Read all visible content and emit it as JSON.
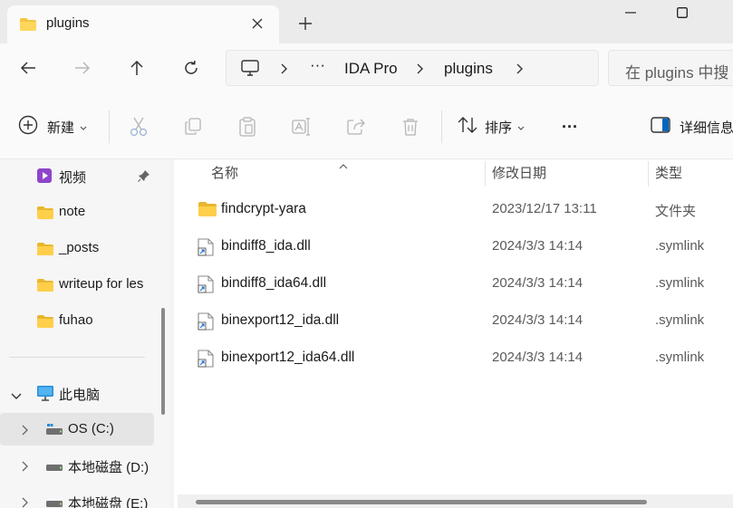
{
  "tab": {
    "title": "plugins"
  },
  "address": {
    "overflow": "···",
    "crumbs": [
      "IDA Pro",
      "plugins"
    ]
  },
  "search": {
    "placeholder": "在 plugins 中搜"
  },
  "toolbar": {
    "new_label": "新建",
    "sort_label": "排序",
    "more_label": "···",
    "details_label": "详细信息"
  },
  "sidebar": {
    "quick_access": [
      {
        "label": "视频",
        "icon": "video-folder-icon",
        "pinned": true
      },
      {
        "label": "note",
        "icon": "folder-icon"
      },
      {
        "label": "_posts",
        "icon": "folder-icon"
      },
      {
        "label": "writeup for les",
        "icon": "folder-icon"
      },
      {
        "label": "fuhao",
        "icon": "folder-icon"
      }
    ],
    "this_pc": {
      "label": "此电脑",
      "expanded": true
    },
    "drives": [
      {
        "label": "OS (C:)",
        "selected": true
      },
      {
        "label": "本地磁盘 (D:)"
      },
      {
        "label": "本地磁盘 (E:)"
      }
    ]
  },
  "columns": {
    "name": "名称",
    "modified": "修改日期",
    "type": "类型"
  },
  "files": [
    {
      "name": "findcrypt-yara",
      "modified": "2023/12/17 13:11",
      "type": "文件夹",
      "icon": "folder-icon"
    },
    {
      "name": "bindiff8_ida.dll",
      "modified": "2024/3/3 14:14",
      "type": ".symlink",
      "icon": "symlink-file-icon"
    },
    {
      "name": "bindiff8_ida64.dll",
      "modified": "2024/3/3 14:14",
      "type": ".symlink",
      "icon": "symlink-file-icon"
    },
    {
      "name": "binexport12_ida.dll",
      "modified": "2024/3/3 14:14",
      "type": ".symlink",
      "icon": "symlink-file-icon"
    },
    {
      "name": "binexport12_ida64.dll",
      "modified": "2024/3/3 14:14",
      "type": ".symlink",
      "icon": "symlink-file-icon"
    }
  ],
  "colors": {
    "folder": "#f4c542",
    "accent": "#0067c0",
    "selected_bg": "#e5e5e5"
  }
}
